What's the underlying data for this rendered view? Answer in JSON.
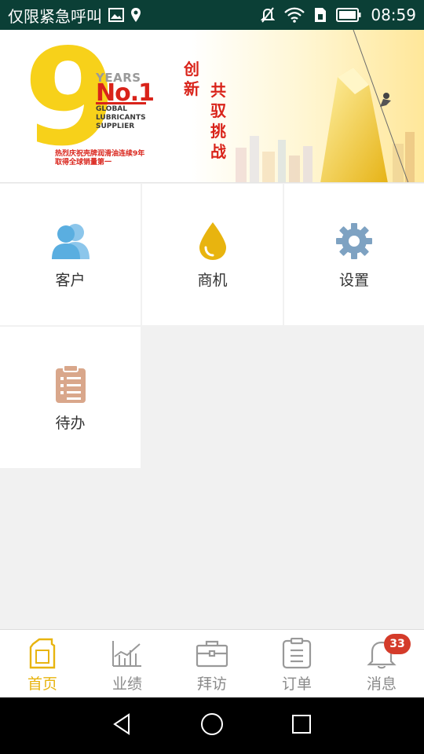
{
  "status_bar": {
    "carrier": "仅限紧急呼叫",
    "time": "08:59",
    "icons": [
      "gallery-icon",
      "location-icon",
      "mute-icon",
      "wifi-icon",
      "sim-icon",
      "battery-icon"
    ]
  },
  "banner": {
    "number": "9",
    "years": "YEARS",
    "no1": "No.1",
    "global_lines": [
      "GLOBAL",
      "LUBRICANTS",
      "SUPPLIER"
    ],
    "cn_line1": "热烈庆祝壳牌润滑油连续9年",
    "cn_line2": "取得全球销量第一",
    "slogan_a": "创新",
    "slogan_b": "共驭挑战"
  },
  "tiles": [
    {
      "label": "客户",
      "icon": "customers-icon",
      "color": "#5aaee0"
    },
    {
      "label": "商机",
      "icon": "oil-drop-icon",
      "color": "#e8b40f"
    },
    {
      "label": "设置",
      "icon": "gear-icon",
      "color": "#7ea2c2"
    },
    {
      "label": "待办",
      "icon": "clipboard-icon",
      "color": "#d9a78b"
    }
  ],
  "tabs": [
    {
      "label": "首页",
      "icon": "oil-can-icon",
      "active": true
    },
    {
      "label": "业绩",
      "icon": "chart-icon",
      "active": false
    },
    {
      "label": "拜访",
      "icon": "briefcase-icon",
      "active": false
    },
    {
      "label": "订单",
      "icon": "order-icon",
      "active": false
    },
    {
      "label": "消息",
      "icon": "bell-icon",
      "active": false,
      "badge": "33"
    }
  ],
  "colors": {
    "accent": "#e8b40f",
    "badge": "#d43b2a",
    "statusbar": "#0b3f36"
  }
}
